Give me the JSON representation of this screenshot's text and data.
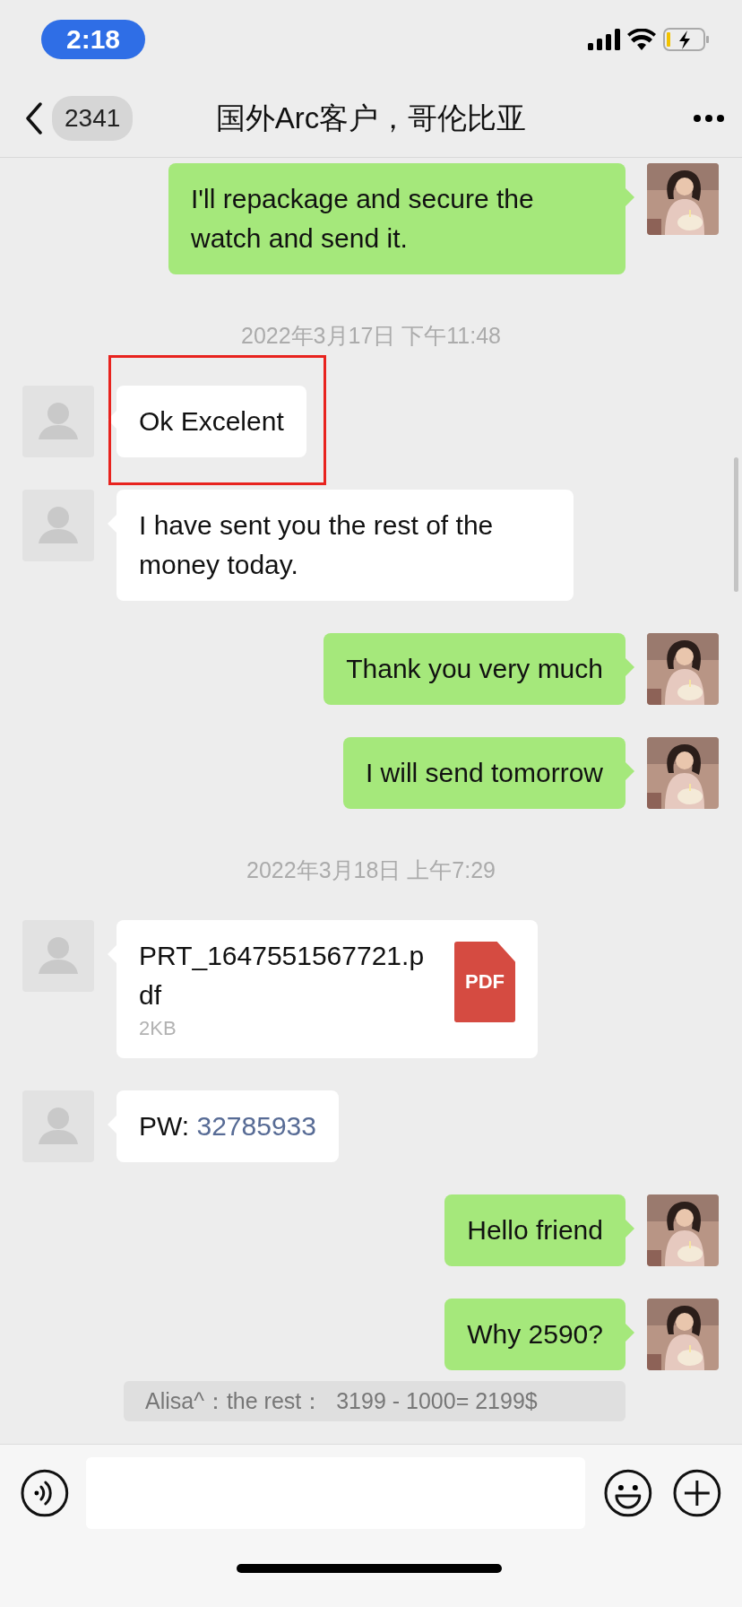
{
  "status_bar": {
    "time": "2:18"
  },
  "header": {
    "back_badge": "2341",
    "title": "国外Arc客户，哥伦比亚"
  },
  "messages": [
    {
      "kind": "sent",
      "text": "I'll repackage and secure the watch and send it.",
      "highlighted": false
    },
    {
      "kind": "timestamp",
      "text": "2022年3月17日 下午11:48"
    },
    {
      "kind": "received",
      "text": "Ok Excelent",
      "highlighted": true
    },
    {
      "kind": "received",
      "text": "I have sent you the rest of the money today.",
      "highlighted": false
    },
    {
      "kind": "sent",
      "text": "Thank you very much",
      "highlighted": false
    },
    {
      "kind": "sent",
      "text": "I will send tomorrow",
      "highlighted": false
    },
    {
      "kind": "timestamp",
      "text": "2022年3月18日 上午7:29"
    },
    {
      "kind": "file",
      "name": "PRT_1647551567721.pdf",
      "size": "2KB",
      "icon_label": "PDF",
      "highlighted": false
    },
    {
      "kind": "received",
      "text": "PW: ",
      "link": "32785933",
      "highlighted": false
    },
    {
      "kind": "sent",
      "text": "Hello friend",
      "highlighted": false
    },
    {
      "kind": "sent",
      "text": "Why 2590?",
      "highlighted": false
    }
  ],
  "quote": "Alisa^：the rest：  3199 - 1000= 2199$"
}
